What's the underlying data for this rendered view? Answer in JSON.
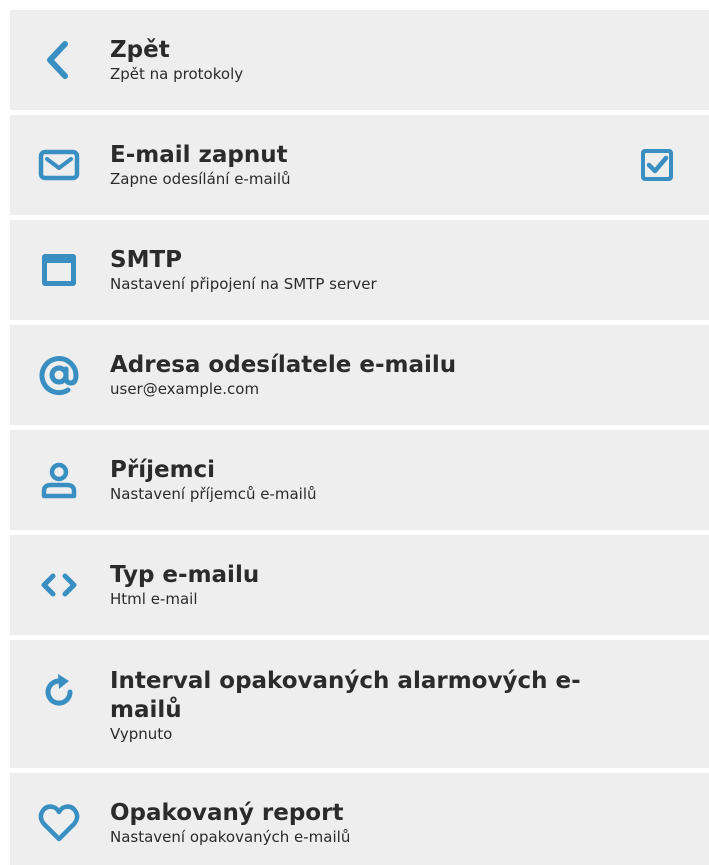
{
  "accent_color": "#3a8fc2",
  "items": [
    {
      "icon": "chevron-left-icon",
      "title": "Zpět",
      "subtitle": "Zpět na protokoly"
    },
    {
      "icon": "envelope-icon",
      "title": "E-mail zapnut",
      "subtitle": "Zapne odesílání e-mailů",
      "checked": true
    },
    {
      "icon": "window-icon",
      "title": "SMTP",
      "subtitle": "Nastavení připojení na SMTP server"
    },
    {
      "icon": "at-sign-icon",
      "title": "Adresa odesílatele e-mailu",
      "subtitle": "user@example.com"
    },
    {
      "icon": "user-icon",
      "title": "Příjemci",
      "subtitle": "Nastavení příjemců e-mailů"
    },
    {
      "icon": "code-icon",
      "title": "Typ e-mailu",
      "subtitle": "Html e-mail"
    },
    {
      "icon": "refresh-icon",
      "title": "Interval opakovaných alarmových e-mailů",
      "subtitle": "Vypnuto"
    },
    {
      "icon": "heart-icon",
      "title": "Opakovaný report",
      "subtitle": "Nastavení opakovaných e-mailů"
    }
  ]
}
